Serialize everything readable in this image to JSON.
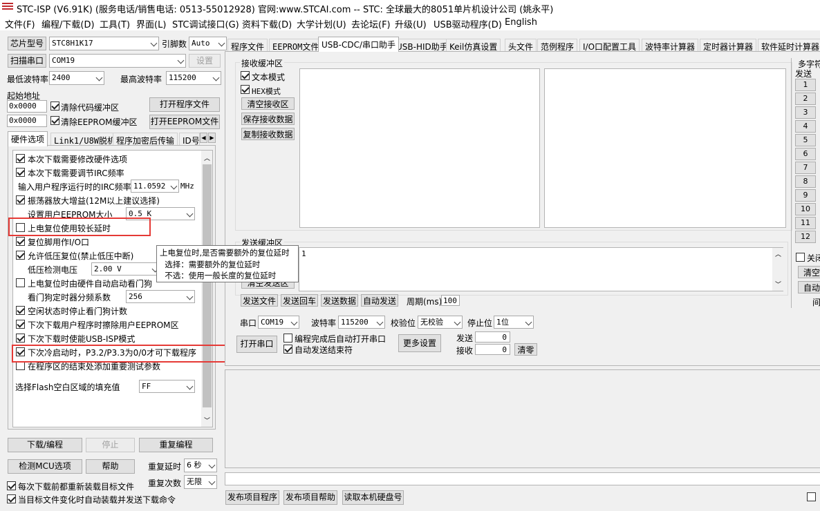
{
  "window": {
    "title": "STC-ISP (V6.91K) (服务电话/销售电话: 0513-55012928) 官网:www.STCAI.com  -- STC: 全球最大的8051单片机设计公司 (姚永平)"
  },
  "menu": [
    "文件(F)",
    "编程/下载(D)",
    "工具(T)",
    "界面(L)",
    "STC调试接口(G)",
    "资料下载(D)",
    "大学计划(U)",
    "去论坛(F)",
    "升级(U)",
    "USB驱动程序(D)",
    "English"
  ],
  "left": {
    "chip_btn": "芯片型号",
    "chip_value": "STC8H1K17",
    "pin_label": "引脚数",
    "pin_value": "Auto",
    "scan_btn": "扫描串口",
    "port_value": "COM19",
    "settings_btn": "设置",
    "min_baud_label": "最低波特率",
    "min_baud": "2400",
    "max_baud_label": "最高波特率",
    "max_baud": "115200",
    "start_addr_label": "起始地址",
    "addr1": "0x0000",
    "clear_code": "清除代码缓冲区",
    "open_prog": "打开程序文件",
    "addr2": "0x0000",
    "clear_eeprom": "清除EEPROM缓冲区",
    "open_eeprom": "打开EEPROM文件",
    "tabs": [
      "硬件选项",
      "Link1/U8W脱机",
      "程序加密后传输",
      "ID号"
    ],
    "opts": [
      {
        "label": "本次下载需要修改硬件选项",
        "checked": true
      },
      {
        "label": "本次下载需要调节IRC频率",
        "checked": true
      },
      {
        "label": "输入用户程序运行时的IRC频率",
        "value": "11.0592",
        "unit": "MHz"
      },
      {
        "label": "振荡器放大增益(12M以上建议选择)",
        "checked": true
      },
      {
        "label": "设置用户EEPROM大小",
        "value": "0.5 K"
      },
      {
        "label": "上电复位使用较长延时",
        "checked": false
      },
      {
        "label": "复位脚用作I/O口",
        "checked": true
      },
      {
        "label": "允许低压复位(禁止低压中断)",
        "checked": true
      },
      {
        "label": "低压检测电压",
        "value": "2.00 V"
      },
      {
        "label": "上电复位时由硬件自动启动看门狗",
        "checked": false
      },
      {
        "label": "看门狗定时器分频系数",
        "value": "256"
      },
      {
        "label": "空闲状态时停止看门狗计数",
        "checked": true
      },
      {
        "label": "下次下载用户程序时擦除用户EEPROM区",
        "checked": true
      },
      {
        "label": "下次下载时使能USB-ISP模式",
        "checked": true
      },
      {
        "label": "下次冷启动时，P3.2/P3.3为0/0才可下载程序",
        "checked": true
      },
      {
        "label": "在程序区的结束处添加重要测试参数",
        "checked": false
      },
      {
        "label": "选择Flash空白区域的填充值",
        "value": "FF"
      }
    ],
    "download_btn": "下载/编程",
    "stop_btn": "停止",
    "reprogram_btn": "重复编程",
    "check_mcu_btn": "检测MCU选项",
    "help_btn": "帮助",
    "repeat_delay_label": "重复延时",
    "repeat_delay": "6 秒",
    "repeat_count_label": "重复次数",
    "repeat_count": "无限",
    "reload_label": "每次下载前都重新装载目标文件",
    "autoload_label": "当目标文件变化时自动装载并发送下载命令"
  },
  "right": {
    "tabs": [
      "程序文件",
      "EEPROM文件",
      "USB-CDC/串口助手",
      "USB-HID助手",
      "Keil仿真设置",
      "头文件",
      "范例程序",
      "I/O口配置工具",
      "波特率计算器",
      "定时器计算器",
      "软件延时计算器"
    ],
    "recv_title": "接收缓冲区",
    "text_mode": "文本模式",
    "hex_mode": "HEX模式",
    "clear_recv": "清空接收区",
    "save_recv": "保存接收数据",
    "copy_recv": "复制接收数据",
    "send_title": "发送缓冲区",
    "send_value": "1",
    "clear_send": "清空发送区",
    "send_file": "发送文件",
    "send_enter": "发送回车",
    "send_data": "发送数据",
    "auto_send": "自动发送",
    "period_label": "周期(ms)",
    "period": "100",
    "port_label": "串口",
    "port": "COM19",
    "baud_label": "波特率",
    "baud": "115200",
    "parity_label": "校验位",
    "parity": "无校验",
    "stop_label": "停止位",
    "stop": "1位",
    "open_port": "打开串口",
    "auto_open": "编程完成后自动打开串口",
    "auto_end": "自动发送结束符",
    "more_settings": "更多设置",
    "sent_label": "发送",
    "sent": "0",
    "recv_label": "接收",
    "recv": "0",
    "clear_counts": "清零",
    "publish_prog": "发布项目程序",
    "publish_help": "发布项目帮助",
    "read_disk": "读取本机硬盘号",
    "multi_title": "多字符",
    "multi_send": "发送",
    "nums": [
      "1",
      "2",
      "3",
      "4",
      "5",
      "6",
      "7",
      "8",
      "9",
      "10",
      "11",
      "12"
    ],
    "multi_close": "关闭",
    "multi_clear": "清空",
    "multi_auto": "自动",
    "multi_interval": "间"
  },
  "tooltip": [
    "上电复位时,是否需要额外的复位延时",
    "  选择：需要额外的复位延时",
    "  不选：使用一般长度的复位延时"
  ]
}
